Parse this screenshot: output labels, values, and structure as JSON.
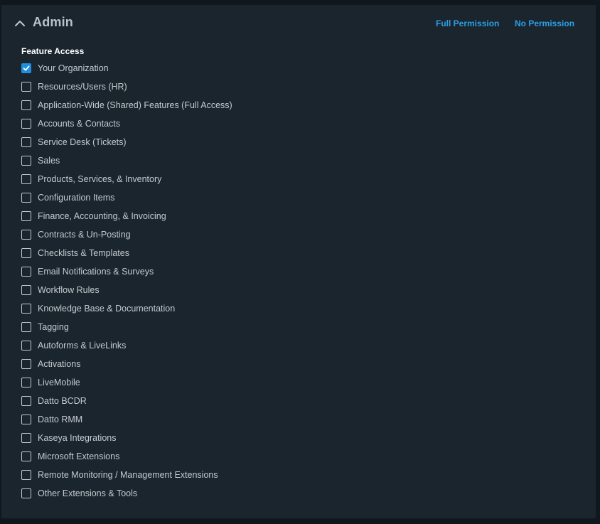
{
  "section": {
    "title": "Admin",
    "full_permission_label": "Full Permission",
    "no_permission_label": "No Permission"
  },
  "feature_access": {
    "label": "Feature Access",
    "items": [
      {
        "label": "Your Organization",
        "checked": true
      },
      {
        "label": "Resources/Users (HR)",
        "checked": false
      },
      {
        "label": "Application-Wide (Shared) Features (Full Access)",
        "checked": false
      },
      {
        "label": "Accounts & Contacts",
        "checked": false
      },
      {
        "label": "Service Desk (Tickets)",
        "checked": false
      },
      {
        "label": "Sales",
        "checked": false
      },
      {
        "label": "Products, Services, & Inventory",
        "checked": false
      },
      {
        "label": "Configuration Items",
        "checked": false
      },
      {
        "label": "Finance, Accounting, & Invoicing",
        "checked": false
      },
      {
        "label": "Contracts & Un-Posting",
        "checked": false
      },
      {
        "label": "Checklists & Templates",
        "checked": false
      },
      {
        "label": "Email Notifications & Surveys",
        "checked": false
      },
      {
        "label": "Workflow Rules",
        "checked": false
      },
      {
        "label": "Knowledge Base & Documentation",
        "checked": false
      },
      {
        "label": "Tagging",
        "checked": false
      },
      {
        "label": "Autoforms & LiveLinks",
        "checked": false
      },
      {
        "label": "Activations",
        "checked": false
      },
      {
        "label": "LiveMobile",
        "checked": false
      },
      {
        "label": "Datto BCDR",
        "checked": false
      },
      {
        "label": "Datto RMM",
        "checked": false
      },
      {
        "label": "Kaseya Integrations",
        "checked": false
      },
      {
        "label": "Microsoft Extensions",
        "checked": false
      },
      {
        "label": "Remote Monitoring / Management Extensions",
        "checked": false
      },
      {
        "label": "Other Extensions & Tools",
        "checked": false
      }
    ]
  },
  "colors": {
    "accent": "#1e8fe0",
    "link": "#2b9fe8",
    "panel": "#1b252d"
  },
  "icons": {
    "collapse": "chevron-up-icon",
    "checked": "checkmark-icon"
  }
}
